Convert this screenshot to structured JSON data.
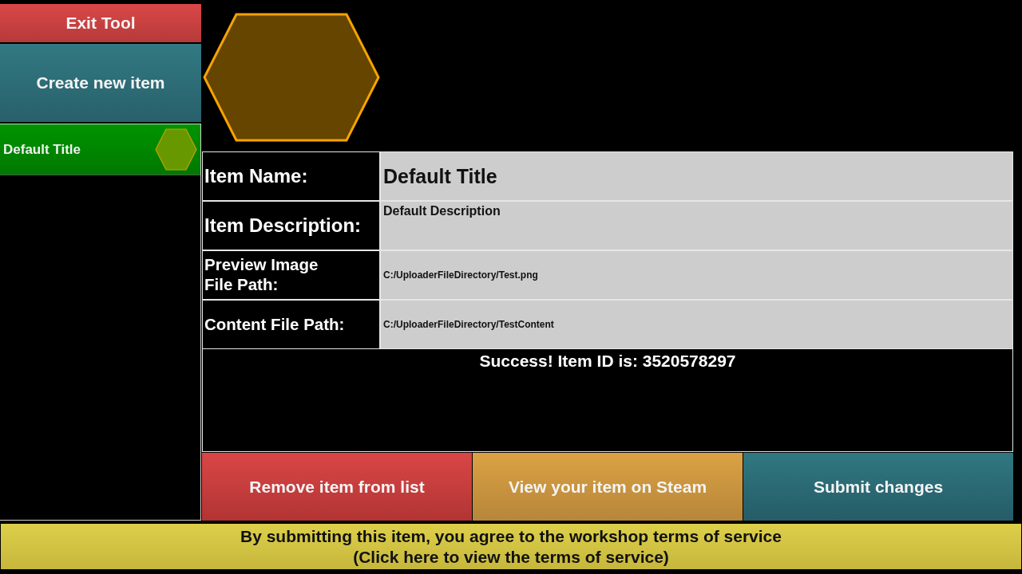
{
  "sidebar": {
    "exit_button": "Exit Tool",
    "create_button": "Create new item",
    "items": [
      {
        "title": "Default Title",
        "selected": true
      }
    ]
  },
  "form": {
    "fields": [
      {
        "kind": "title",
        "label": "Item Name:",
        "value": "Default Title"
      },
      {
        "kind": "text",
        "label": "Item Description:",
        "value": "Default Description"
      },
      {
        "kind": "path",
        "label": "Preview Image\nFile Path:",
        "value": "C:/UploaderFileDirectory/Test.png"
      },
      {
        "kind": "path",
        "label": "Content File Path:",
        "value": "C:/UploaderFileDirectory/TestContent"
      }
    ],
    "status_message": "Success! Item ID is: 3520578297"
  },
  "actions": [
    {
      "kind": "remove",
      "label": "Remove item from list"
    },
    {
      "kind": "view",
      "label": "View your item on Steam"
    },
    {
      "kind": "submit",
      "label": "Submit changes"
    }
  ],
  "terms_button": {
    "lines": [
      "By submitting this item, you agree to the workshop terms of service",
      "(Click here to view the terms of service)"
    ]
  }
}
